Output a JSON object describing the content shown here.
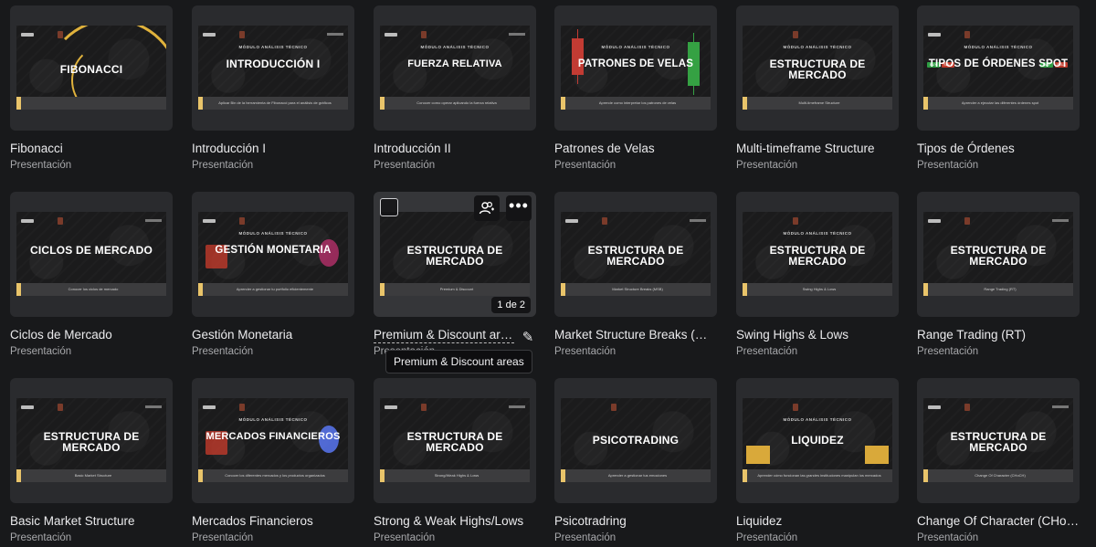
{
  "type_label": "Presentación",
  "cards": [
    {
      "title": "Fibonacci",
      "slide_title": "FIBONACCI",
      "module": "",
      "subtitle": ""
    },
    {
      "title": "Introducción I",
      "slide_title": "INTRODUCCIÓN I",
      "module": "MÓDULO ANÁLISIS TÉCNICO",
      "subtitle": "Aplicar Bin de la herramienta de Fibonacci para el análisis de gráficos"
    },
    {
      "title": "Introducción II",
      "slide_title": "FUERZA RELATIVA",
      "module": "MÓDULO ANÁLISIS TÉCNICO",
      "subtitle": "Conocer como operar aplicando la fuerza relativa"
    },
    {
      "title": "Patrones de Velas",
      "slide_title": "PATRONES DE VELAS",
      "module": "MÓDULO ANÁLISIS TÉCNICO",
      "subtitle": "Aprende como interpretar los patrones de velas"
    },
    {
      "title": "Multi-timeframe Structure",
      "slide_title": "ESTRUCTURA DE MERCADO",
      "module": "MÓDULO ANÁLISIS TÉCNICO",
      "subtitle": "Multi-timeframe Structure"
    },
    {
      "title": "Tipos de Órdenes",
      "slide_title": "TIPOS DE ÓRDENES SPOT",
      "module": "MÓDULO ANÁLISIS TÉCNICO",
      "subtitle": "Aprender a ejecutar las diferentes órdenes spot"
    },
    {
      "title": "Ciclos de Mercado",
      "slide_title": "CICLOS DE MERCADO",
      "module": "",
      "subtitle": "Conocer los ciclos de mercado"
    },
    {
      "title": "Gestión Monetaria",
      "slide_title": "GESTIÓN MONETARIA",
      "module": "MÓDULO ANÁLISIS TÉCNICO",
      "subtitle": "Aprender a gestionar tu portfolio eficientemente"
    },
    {
      "title": "Premium & Discount areas",
      "slide_title": "ESTRUCTURA DE MERCADO",
      "module": "",
      "subtitle": "Premium & Discount",
      "page_badge": "1 de 2"
    },
    {
      "title": "Market Structure Breaks (MSB)",
      "slide_title": "ESTRUCTURA DE MERCADO",
      "module": "",
      "subtitle": "Market Structure Breaks (MSB)"
    },
    {
      "title": "Swing Highs & Lows",
      "slide_title": "ESTRUCTURA DE MERCADO",
      "module": "MÓDULO ANÁLISIS TÉCNICO",
      "subtitle": "Swing Highs & Lows"
    },
    {
      "title": "Range Trading (RT)",
      "slide_title": "ESTRUCTURA DE MERCADO",
      "module": "",
      "subtitle": "Range Trading (RT)"
    },
    {
      "title": "Basic Market Structure",
      "slide_title": "ESTRUCTURA DE MERCADO",
      "module": "",
      "subtitle": "Basic Market Structure"
    },
    {
      "title": "Mercados Financieros",
      "slide_title": "MERCADOS FINANCIEROS",
      "module": "MÓDULO ANÁLISIS TÉCNICO",
      "subtitle": "Conocer los diferentes mercados y los productos organizados"
    },
    {
      "title": "Strong & Weak Highs/Lows",
      "slide_title": "ESTRUCTURA DE MERCADO",
      "module": "",
      "subtitle": "Strong/Weak Highs & Lows"
    },
    {
      "title": "Psicotradring",
      "slide_title": "PSICOTRADING",
      "module": "",
      "subtitle": "Aprender a gestionar tus emociones"
    },
    {
      "title": "Liquidez",
      "slide_title": "LIQUIDEZ",
      "module": "MÓDULO ANÁLISIS TÉCNICO",
      "subtitle": "Aprender cómo funcionan las grandes instituciones manipulan los mercados"
    },
    {
      "title": "Change Of Character (CHoCH)",
      "slide_title": "ESTRUCTURA DE MERCADO",
      "module": "",
      "subtitle": "Change Of Character (CHoCH)"
    }
  ],
  "tooltip": "Premium & Discount areas",
  "icons": {
    "share": "share-people-icon",
    "more": "more-dots-icon",
    "edit": "pencil-icon"
  },
  "colors": {
    "background": "#18191b",
    "card": "#2a2b2e",
    "accent_gold": "#e9c46a"
  }
}
